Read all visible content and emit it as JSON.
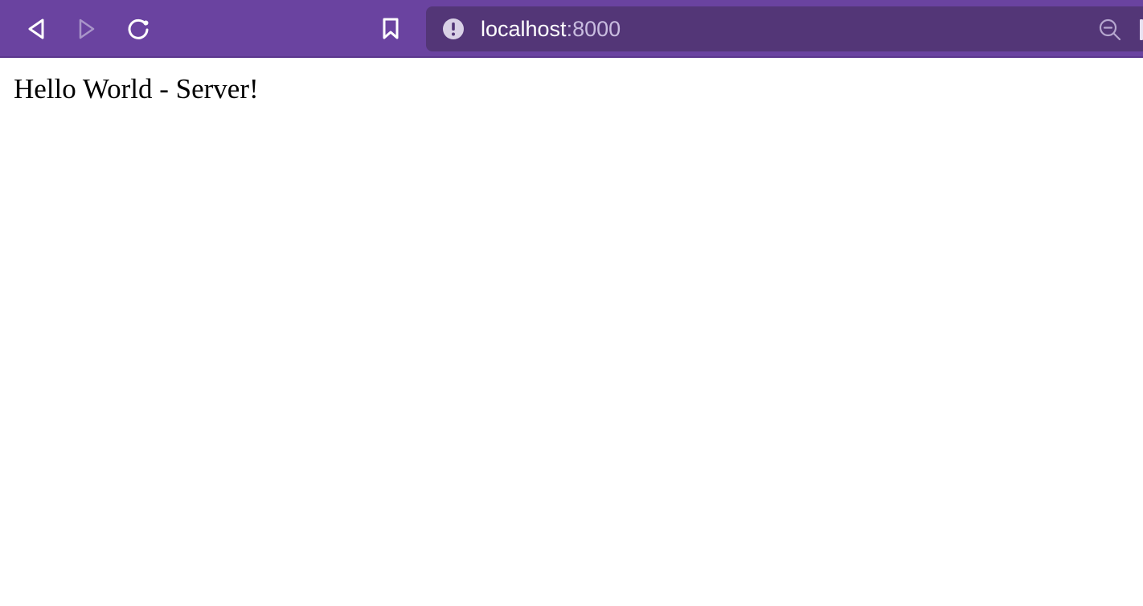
{
  "browser": {
    "toolbar_color": "#6a43a0",
    "urlbar_color": "#533677",
    "buttons": {
      "back_icon": "back-arrow-icon",
      "forward_icon": "forward-arrow-icon",
      "reload_icon": "reload-icon",
      "bookmark_icon": "bookmark-icon",
      "site_info_icon": "info-warning-icon",
      "zoom_icon": "zoom-out-icon"
    },
    "url": {
      "host": "localhost",
      "port": ":8000"
    }
  },
  "page": {
    "text": "Hello World - Server!"
  }
}
